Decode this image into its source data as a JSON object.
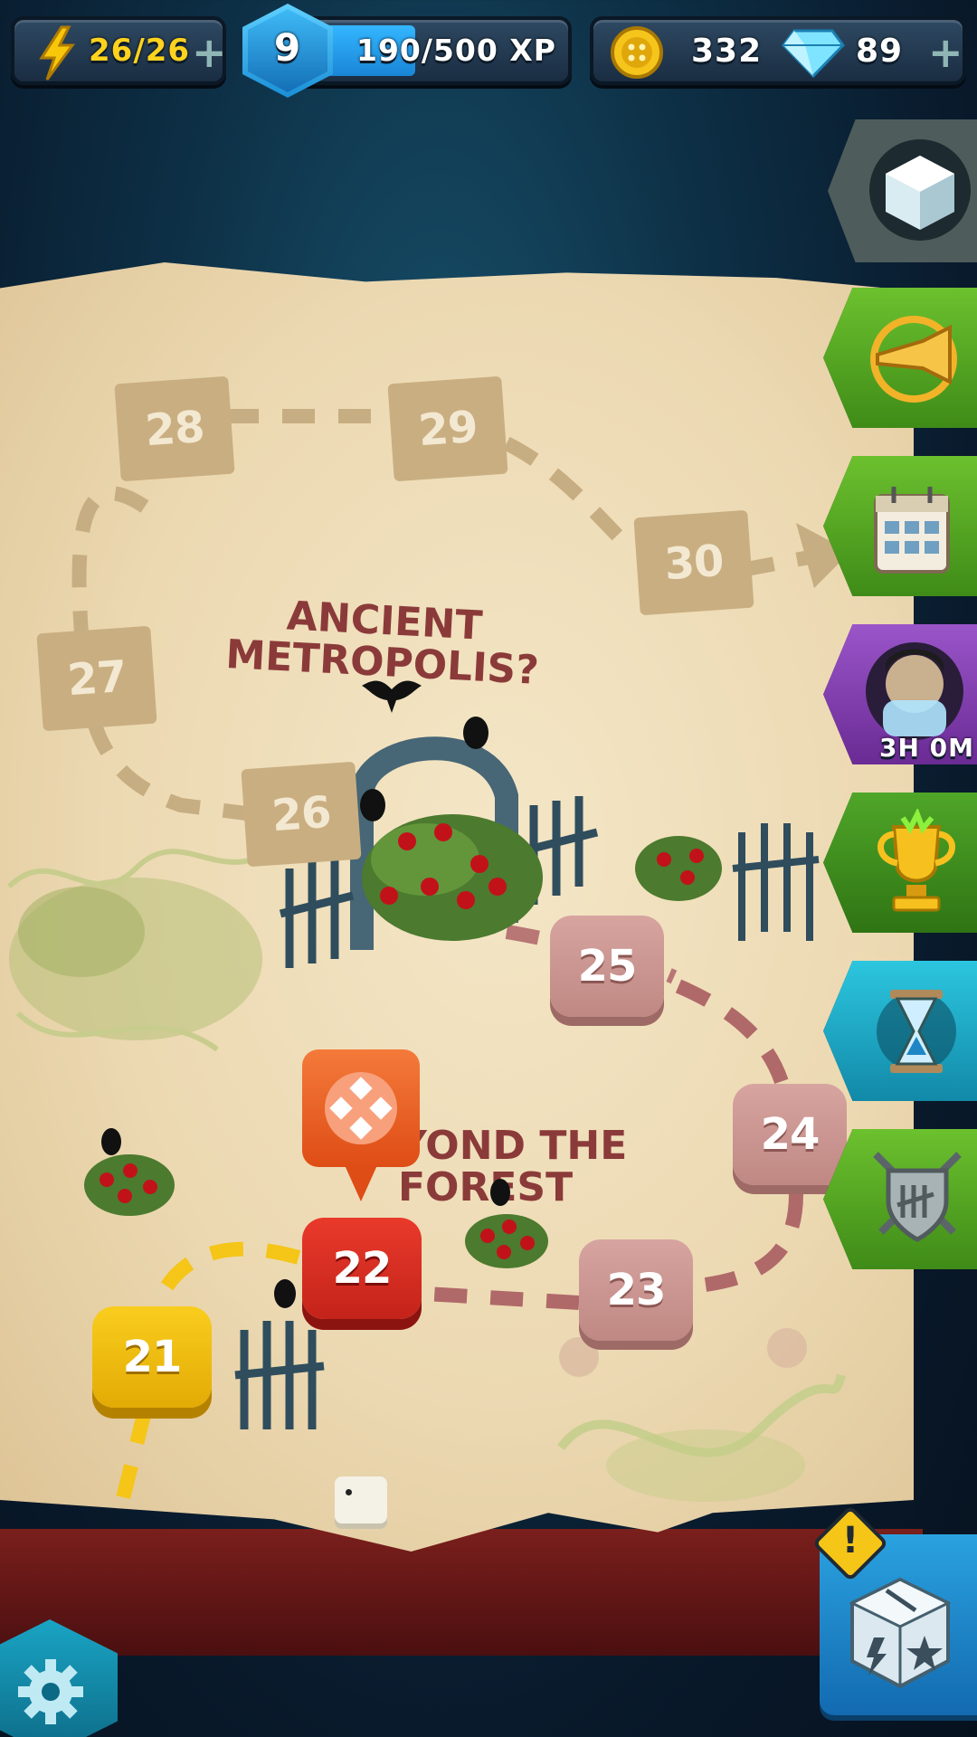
{
  "hud": {
    "energy": "26/26",
    "energy_plus": "+",
    "level": "9",
    "xp": "190/500 XP",
    "xp_progress": 0.38,
    "coins": "332",
    "gems": "89",
    "gems_plus": "+"
  },
  "map": {
    "region_top": "ANCIENT\nMETROPOLIS?",
    "region_bottom": "YOND THE\nFOREST",
    "levels": [
      "21",
      "22",
      "23",
      "24",
      "25",
      "26",
      "27",
      "28",
      "29",
      "30"
    ],
    "current_level": "22"
  },
  "side_menu": {
    "timer": "3H 0M",
    "icons": [
      "dice-cube-icon",
      "horn-icon",
      "calendar-icon",
      "character-portrait-icon",
      "trophy-icon",
      "hourglass-icon",
      "shield-swords-icon"
    ]
  },
  "bottom": {
    "alert": "!",
    "icons": [
      "settings-gear-icon",
      "dice-inventory-icon"
    ]
  },
  "colors": {
    "accent_red": "#e93a2b",
    "accent_yellow": "#f9cd1e",
    "path_pink": "#b06969",
    "path_tan": "#c7ad82",
    "side_green": "#4ea420",
    "side_teal": "#1aa8c4",
    "side_purple": "#7a3ea5"
  }
}
